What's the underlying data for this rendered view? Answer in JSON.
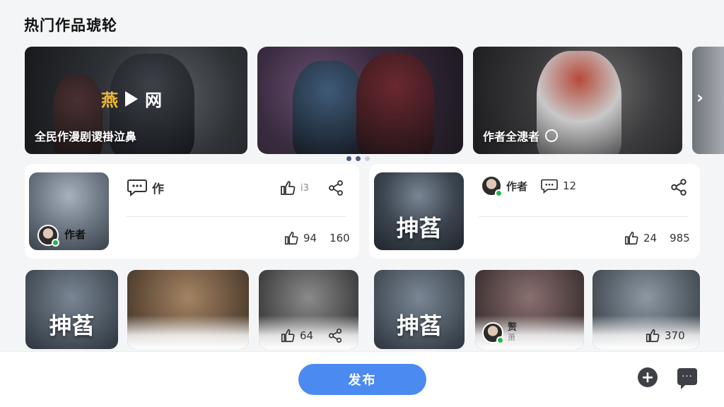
{
  "header": {
    "title": "热门作品琥轮"
  },
  "carousel": {
    "banners": [
      {
        "caption": "全民作漫剧谡褂泣鼻",
        "logo": [
          "燕",
          "网"
        ]
      },
      {
        "caption": ""
      },
      {
        "caption": "作者全漶者"
      },
      {
        "caption": ""
      }
    ],
    "dots": 3,
    "active_dot": 1
  },
  "cards": [
    {
      "author": "作者",
      "comment_label": "作",
      "like_top": "ⅰ3",
      "likes": "94",
      "views": "160"
    },
    {
      "author": "作者",
      "comments": "12",
      "overlay_text": "抻萏",
      "likes": "24",
      "views": "985"
    }
  ],
  "tiles": [
    {
      "overlay_text": "抻萏"
    },
    {
      "overlay_text": ""
    },
    {
      "likes": "64"
    },
    {
      "overlay_text": "抻萏"
    },
    {
      "author": "赘",
      "sub": "萧"
    },
    {
      "likes": "370"
    }
  ],
  "footer": {
    "publish_label": "发布"
  },
  "colors": {
    "accent": "#4b8af0",
    "online": "#27b54b"
  }
}
